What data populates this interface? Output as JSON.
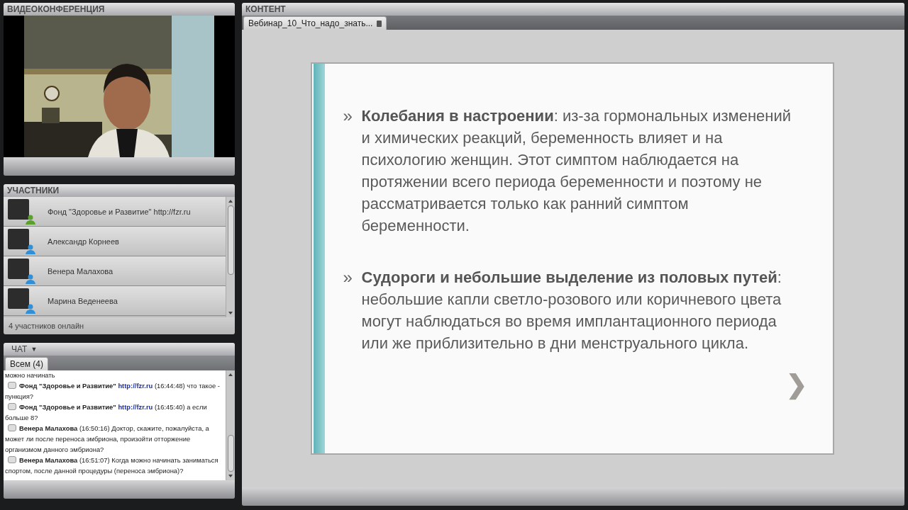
{
  "video_panel": {
    "title": "ВИДЕОКОНФЕРЕНЦИЯ"
  },
  "participants": {
    "title": "УЧАСТНИКИ",
    "items": [
      {
        "name": "Фонд \"Здоровье и Развитие\" http://fzr.ru",
        "color": "#5aa02c"
      },
      {
        "name": "Александр Корнеев",
        "color": "#2f8fd8"
      },
      {
        "name": "Венера Малахова",
        "color": "#2f8fd8"
      },
      {
        "name": "Марина Веденеева",
        "color": "#2f8fd8"
      }
    ],
    "footer": "4 участников онлайн"
  },
  "chat": {
    "title": "ЧАТ",
    "dropdown_caret": "▼",
    "tabs": [
      {
        "label": "Всем (4)",
        "selected": true
      }
    ],
    "messages": [
      {
        "kind": "continuation",
        "text": "можно начинать"
      },
      {
        "kind": "message",
        "author": "Фонд \"Здоровье и Развитие\"",
        "link": "http://fzr.ru",
        "time": "(16:44:48)",
        "text": "что такое - пункция?"
      },
      {
        "kind": "message",
        "author": "Фонд \"Здоровье и Развитие\"",
        "link": "http://fzr.ru",
        "time": "(16:45:40)",
        "text": "а если больше 8?"
      },
      {
        "kind": "message",
        "author": "Венера Малахова",
        "time": "(16:50:16)",
        "text": "Доктор, скажите, пожалуйста, а может ли после переноса эмбриона, произойти отторжение организмом данного эмбриона?"
      },
      {
        "kind": "message",
        "author": "Венера Малахова",
        "time": "(16:51:07)",
        "text": "Когда можно начинать заниматься спортом, после данной процедуры (переноса эмбриона)?"
      }
    ]
  },
  "content": {
    "title": "КОНТЕНТ",
    "tabs": [
      {
        "label": "Вебинар_10_Что_надо_знать...",
        "selected": true
      }
    ],
    "slide": {
      "bullets": [
        {
          "marker": "»",
          "text": "**Колебания в настроении**: из-за гормональных изменений и химических реакций, беременность влияет и на психологию женщин. Этот симптом наблюдается на протяжении всего периода беременности и поэтому не рассматривается только как ранний симптом беременности."
        },
        {
          "marker": "»",
          "text": "**Судороги и небольшие выделение из половых путей**: небольшие капли светло-розового или коричневого цвета могут наблюдаться во время имплантационного периода или же приблизительно в дни менструального цикла."
        }
      ],
      "next": "❯"
    }
  }
}
